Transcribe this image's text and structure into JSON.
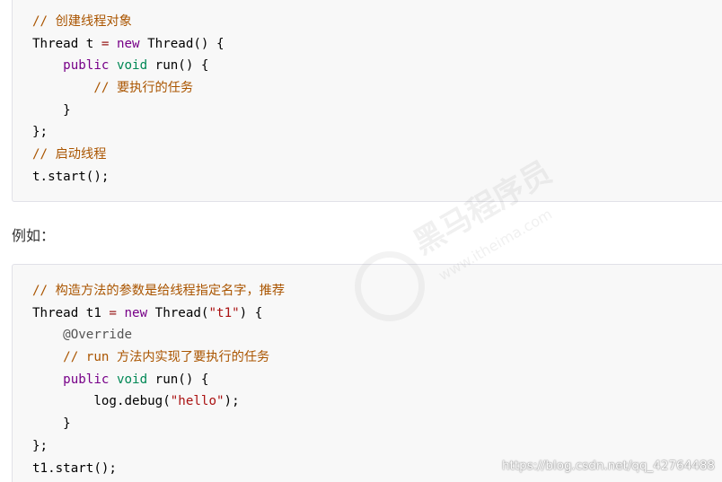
{
  "colors": {
    "comment": "#aa5500",
    "keyword": "#770088",
    "type": "#008855",
    "string": "#aa1111",
    "operator": "#981a1a",
    "annotation": "#555555",
    "background": "#f8f8f8"
  },
  "block1": {
    "lines": [
      [
        [
          "comment",
          "// 创建线程对象"
        ]
      ],
      [
        [
          "plain",
          "Thread t "
        ],
        [
          "op",
          "="
        ],
        [
          "plain",
          " "
        ],
        [
          "kw",
          "new"
        ],
        [
          "plain",
          " Thread() {"
        ]
      ],
      [
        [
          "plain",
          "    "
        ],
        [
          "kw",
          "public"
        ],
        [
          "plain",
          " "
        ],
        [
          "type",
          "void"
        ],
        [
          "plain",
          " run() {"
        ]
      ],
      [
        [
          "plain",
          "        "
        ],
        [
          "comment",
          "// 要执行的任务"
        ]
      ],
      [
        [
          "plain",
          "    }"
        ]
      ],
      [
        [
          "plain",
          "};"
        ]
      ],
      [
        [
          "comment",
          "// 启动线程"
        ]
      ],
      [
        [
          "plain",
          "t.start();"
        ]
      ]
    ]
  },
  "example_label": "例如：",
  "block2": {
    "lines": [
      [
        [
          "comment",
          "// 构造方法的参数是给线程指定名字，推荐"
        ]
      ],
      [
        [
          "plain",
          "Thread t1 "
        ],
        [
          "op",
          "="
        ],
        [
          "plain",
          " "
        ],
        [
          "kw",
          "new"
        ],
        [
          "plain",
          " Thread("
        ],
        [
          "str",
          "\"t1\""
        ],
        [
          "plain",
          ") {"
        ]
      ],
      [
        [
          "plain",
          "    "
        ],
        [
          "meta",
          "@Override"
        ]
      ],
      [
        [
          "plain",
          "    "
        ],
        [
          "comment",
          "// run 方法内实现了要执行的任务"
        ]
      ],
      [
        [
          "plain",
          "    "
        ],
        [
          "kw",
          "public"
        ],
        [
          "plain",
          " "
        ],
        [
          "type",
          "void"
        ],
        [
          "plain",
          " run() {"
        ]
      ],
      [
        [
          "plain",
          "        log.debug("
        ],
        [
          "str",
          "\"hello\""
        ],
        [
          "plain",
          ");"
        ]
      ],
      [
        [
          "plain",
          "    }"
        ]
      ],
      [
        [
          "plain",
          "};"
        ]
      ],
      [
        [
          "plain",
          "t1.start();"
        ]
      ]
    ]
  },
  "watermark": {
    "brand": "黑马程序员",
    "site": "www.itheima.com"
  },
  "source_url": "https://blog.csdn.net/qq_42764488"
}
